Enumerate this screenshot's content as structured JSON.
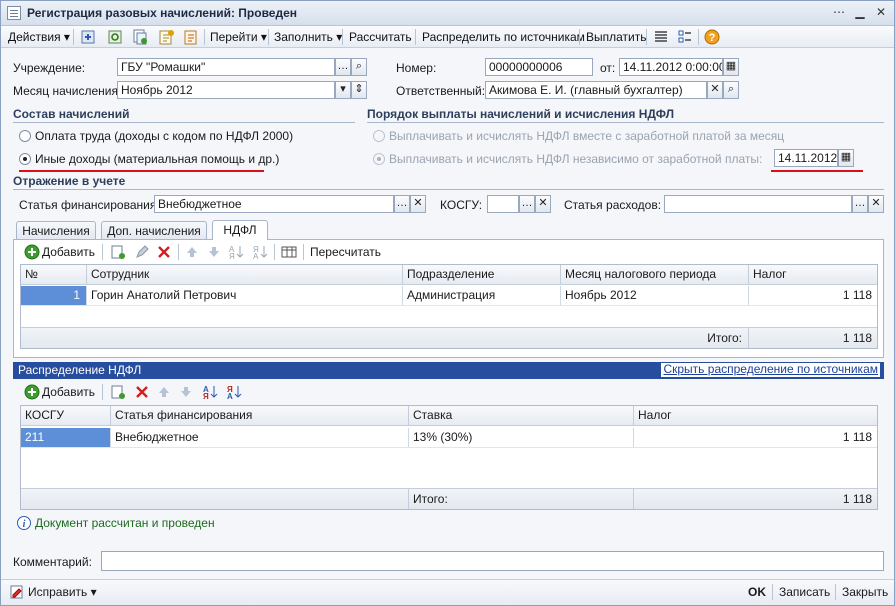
{
  "window": {
    "title": "Регистрация разовых начислений: Проведен"
  },
  "toolbar": {
    "actions": "Действия",
    "goto": "Перейти",
    "fill": "Заполнить",
    "calculate": "Рассчитать",
    "distribute": "Распределить по источникам",
    "pay": "Выплатить"
  },
  "header": {
    "institution_label": "Учреждение:",
    "institution_value": "ГБУ \"Ромашки\"",
    "month_label": "Месяц начисления:",
    "month_value": "Ноябрь 2012",
    "number_label": "Номер:",
    "number_value": "00000000006",
    "date_from_label": "от:",
    "date_value": "14.11.2012  0:00:00",
    "responsible_label": "Ответственный:",
    "responsible_value": "Акимова Е. И. (главный бухгалтер)"
  },
  "composition": {
    "title": "Состав начислений",
    "option1": "Оплата труда (доходы с кодом по НДФЛ 2000)",
    "option2": "Иные доходы (материальная помощь и др.)",
    "selected": 2
  },
  "payment_order": {
    "title": "Порядок выплаты начислений и исчисления НДФЛ",
    "option1": "Выплачивать и исчислять НДФЛ вместе с заработной платой за месяц",
    "option2": "Выплачивать и исчислять НДФЛ независимо от заработной платы:",
    "date_value": "14.11.2012"
  },
  "accounting": {
    "title": "Отражение в учете",
    "financing_label": "Статья финансирования:",
    "financing_value": "Внебюджетное",
    "kosgu_label": "КОСГУ:",
    "kosgu_value": "",
    "expense_label": "Статья расходов:",
    "expense_value": ""
  },
  "tabs": [
    {
      "label": "Начисления"
    },
    {
      "label": "Доп. начисления"
    },
    {
      "label": "НДФЛ"
    }
  ],
  "ndfl_toolbar": {
    "add": "Добавить",
    "recalc": "Пересчитать"
  },
  "ndfl_table": {
    "columns": [
      "№",
      "Сотрудник",
      "Подразделение",
      "Месяц налогового периода",
      "Налог"
    ],
    "rows": [
      {
        "n": "1",
        "employee": "Горин Анатолий Петрович",
        "department": "Администрация",
        "month": "Ноябрь 2012",
        "tax": "1 118"
      }
    ],
    "total_label": "Итого:",
    "total_value": "1 118"
  },
  "distribution": {
    "title": "Распределение НДФЛ",
    "hide_link": "Скрыть распределение по источникам",
    "add": "Добавить",
    "columns": [
      "КОСГУ",
      "Статья финансирования",
      "Ставка",
      "Налог"
    ],
    "rows": [
      {
        "kosgu": "211",
        "financing": "Внебюджетное",
        "rate": "13% (30%)",
        "tax": "1 118"
      }
    ],
    "total_label": "Итого:",
    "total_value": "1 118"
  },
  "status": {
    "text": "Документ рассчитан и проведен"
  },
  "comment": {
    "label": "Комментарий:",
    "value": ""
  },
  "bottom": {
    "fix": "Исправить",
    "ok": "OK",
    "save": "Записать",
    "close": "Закрыть"
  }
}
